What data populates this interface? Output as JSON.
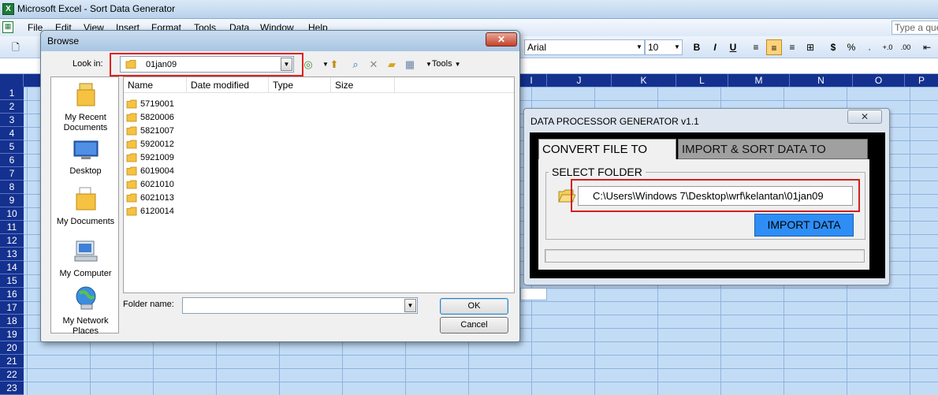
{
  "excel": {
    "title": "Microsoft Excel - Sort Data Generator",
    "menu": [
      "File",
      "Edit",
      "View",
      "Insert",
      "Format",
      "Tools",
      "Data",
      "Window",
      "Help"
    ],
    "ask_placeholder": "Type a que",
    "font_name": "Arial",
    "font_size": "10",
    "columns": [
      "I",
      "J",
      "K",
      "L",
      "M",
      "N",
      "O",
      "P"
    ],
    "rows": [
      "1",
      "2",
      "3",
      "4",
      "5",
      "6",
      "7",
      "8",
      "9",
      "10",
      "11",
      "12",
      "13",
      "14",
      "15",
      "16",
      "17",
      "18",
      "19",
      "20",
      "21",
      "22",
      "23"
    ]
  },
  "browse": {
    "title": "Browse",
    "lookin_label": "Look in:",
    "lookin_value": "01jan09",
    "tools_label": "Tools",
    "places": [
      {
        "label": "My Recent Documents",
        "icon": "recent-documents-icon"
      },
      {
        "label": "Desktop",
        "icon": "desktop-icon"
      },
      {
        "label": "My Documents",
        "icon": "my-documents-icon"
      },
      {
        "label": "My Computer",
        "icon": "my-computer-icon"
      },
      {
        "label": "My Network Places",
        "icon": "network-places-icon"
      }
    ],
    "columns": [
      "Name",
      "Date modified",
      "Type",
      "Size"
    ],
    "folders": [
      "5719001",
      "5820006",
      "5821007",
      "5920012",
      "5921009",
      "6019004",
      "6021010",
      "6021013",
      "6120014"
    ],
    "folder_name_label": "Folder name:",
    "folder_name_value": "",
    "ok_label": "OK",
    "cancel_label": "Cancel"
  },
  "processor": {
    "title": "DATA PROCESSOR GENERATOR v1.1",
    "tabs": [
      "CONVERT FILE TO .CSV",
      "IMPORT & SORT DATA TO EXCEL"
    ],
    "active_tab": "CONVERT FILE TO .CSV",
    "select_folder_label": "SELECT FOLDER",
    "path": "C:\\Users\\Windows 7\\Desktop\\wrf\\kelantan\\01jan09",
    "import_label": "IMPORT DATA",
    "progress": 0
  },
  "colors": {
    "header_blue": "#14318f",
    "grid_fill": "#c3dcf6",
    "highlight_red": "#e02020",
    "import_button": "#2e8ef5"
  }
}
